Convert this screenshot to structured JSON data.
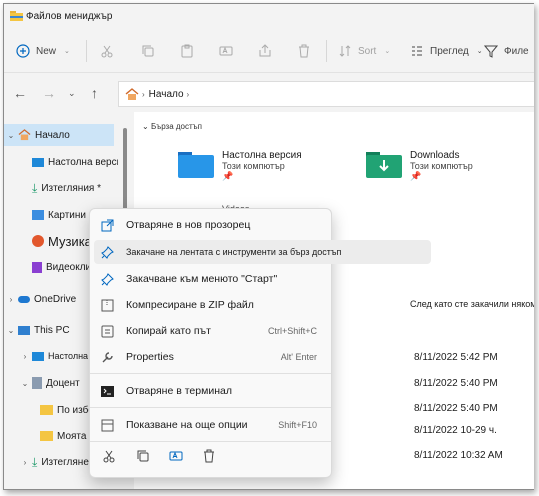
{
  "window": {
    "title": "Файлов мениджър"
  },
  "toolbar": {
    "new_label": "New",
    "sort_label": "Sort",
    "view_label": "Преглед",
    "filter_label": "Филе"
  },
  "address": {
    "crumb": "Начало"
  },
  "sidebar": {
    "home": "Начало",
    "desktop": "Настолна версия",
    "downloads": "Изтегляния *",
    "pictures": "Картини",
    "music": "Музика",
    "videos": "Видеоклипове",
    "onedrive": "OneDrive",
    "thispc": "This PC",
    "pc_desktop": "Настолна версия",
    "docs": "Доцент",
    "folder1": "По избор",
    "folder2": "Моята статистика",
    "pc_downloads": "Изтегляне"
  },
  "content": {
    "quick_access": "Бърза достъп",
    "tile1_name": "Настолна версия",
    "tile1_sub": "Този компютър",
    "tile2_name": "Downloads",
    "tile2_sub": "Този компютър",
    "tile3_name": "Videos",
    "recent_note": "След като сте закачили няком",
    "dates": [
      "8/11/2022 5:42 PM",
      "8/11/2022 5:40 PM",
      "8/11/2022 5:40 PM",
      "8/11/2022 10-29 ч.",
      "8/11/2022 10:32 AM"
    ]
  },
  "context_menu": {
    "open_new_window": "Отваряне в нов прозорец",
    "pin_quick_access": "Закачане на лентата с инструменти за бърз достъп",
    "pin_start": "Закачване към менюто \"Старт\"",
    "compress_zip": "Компресиране в ZIP файл",
    "copy_path": "Копирай като път",
    "copy_path_shortcut": "Ctrl+Shift+C",
    "properties": "Properties",
    "properties_shortcut": "Alt' Enter",
    "open_terminal": "Отваряне в терминал",
    "more_options": "Показване на още опции",
    "more_options_shortcut": "Shift+F10"
  },
  "colors": {
    "accent": "#0067c0",
    "selection": "#cce4f7",
    "folder": "#f4c542"
  }
}
